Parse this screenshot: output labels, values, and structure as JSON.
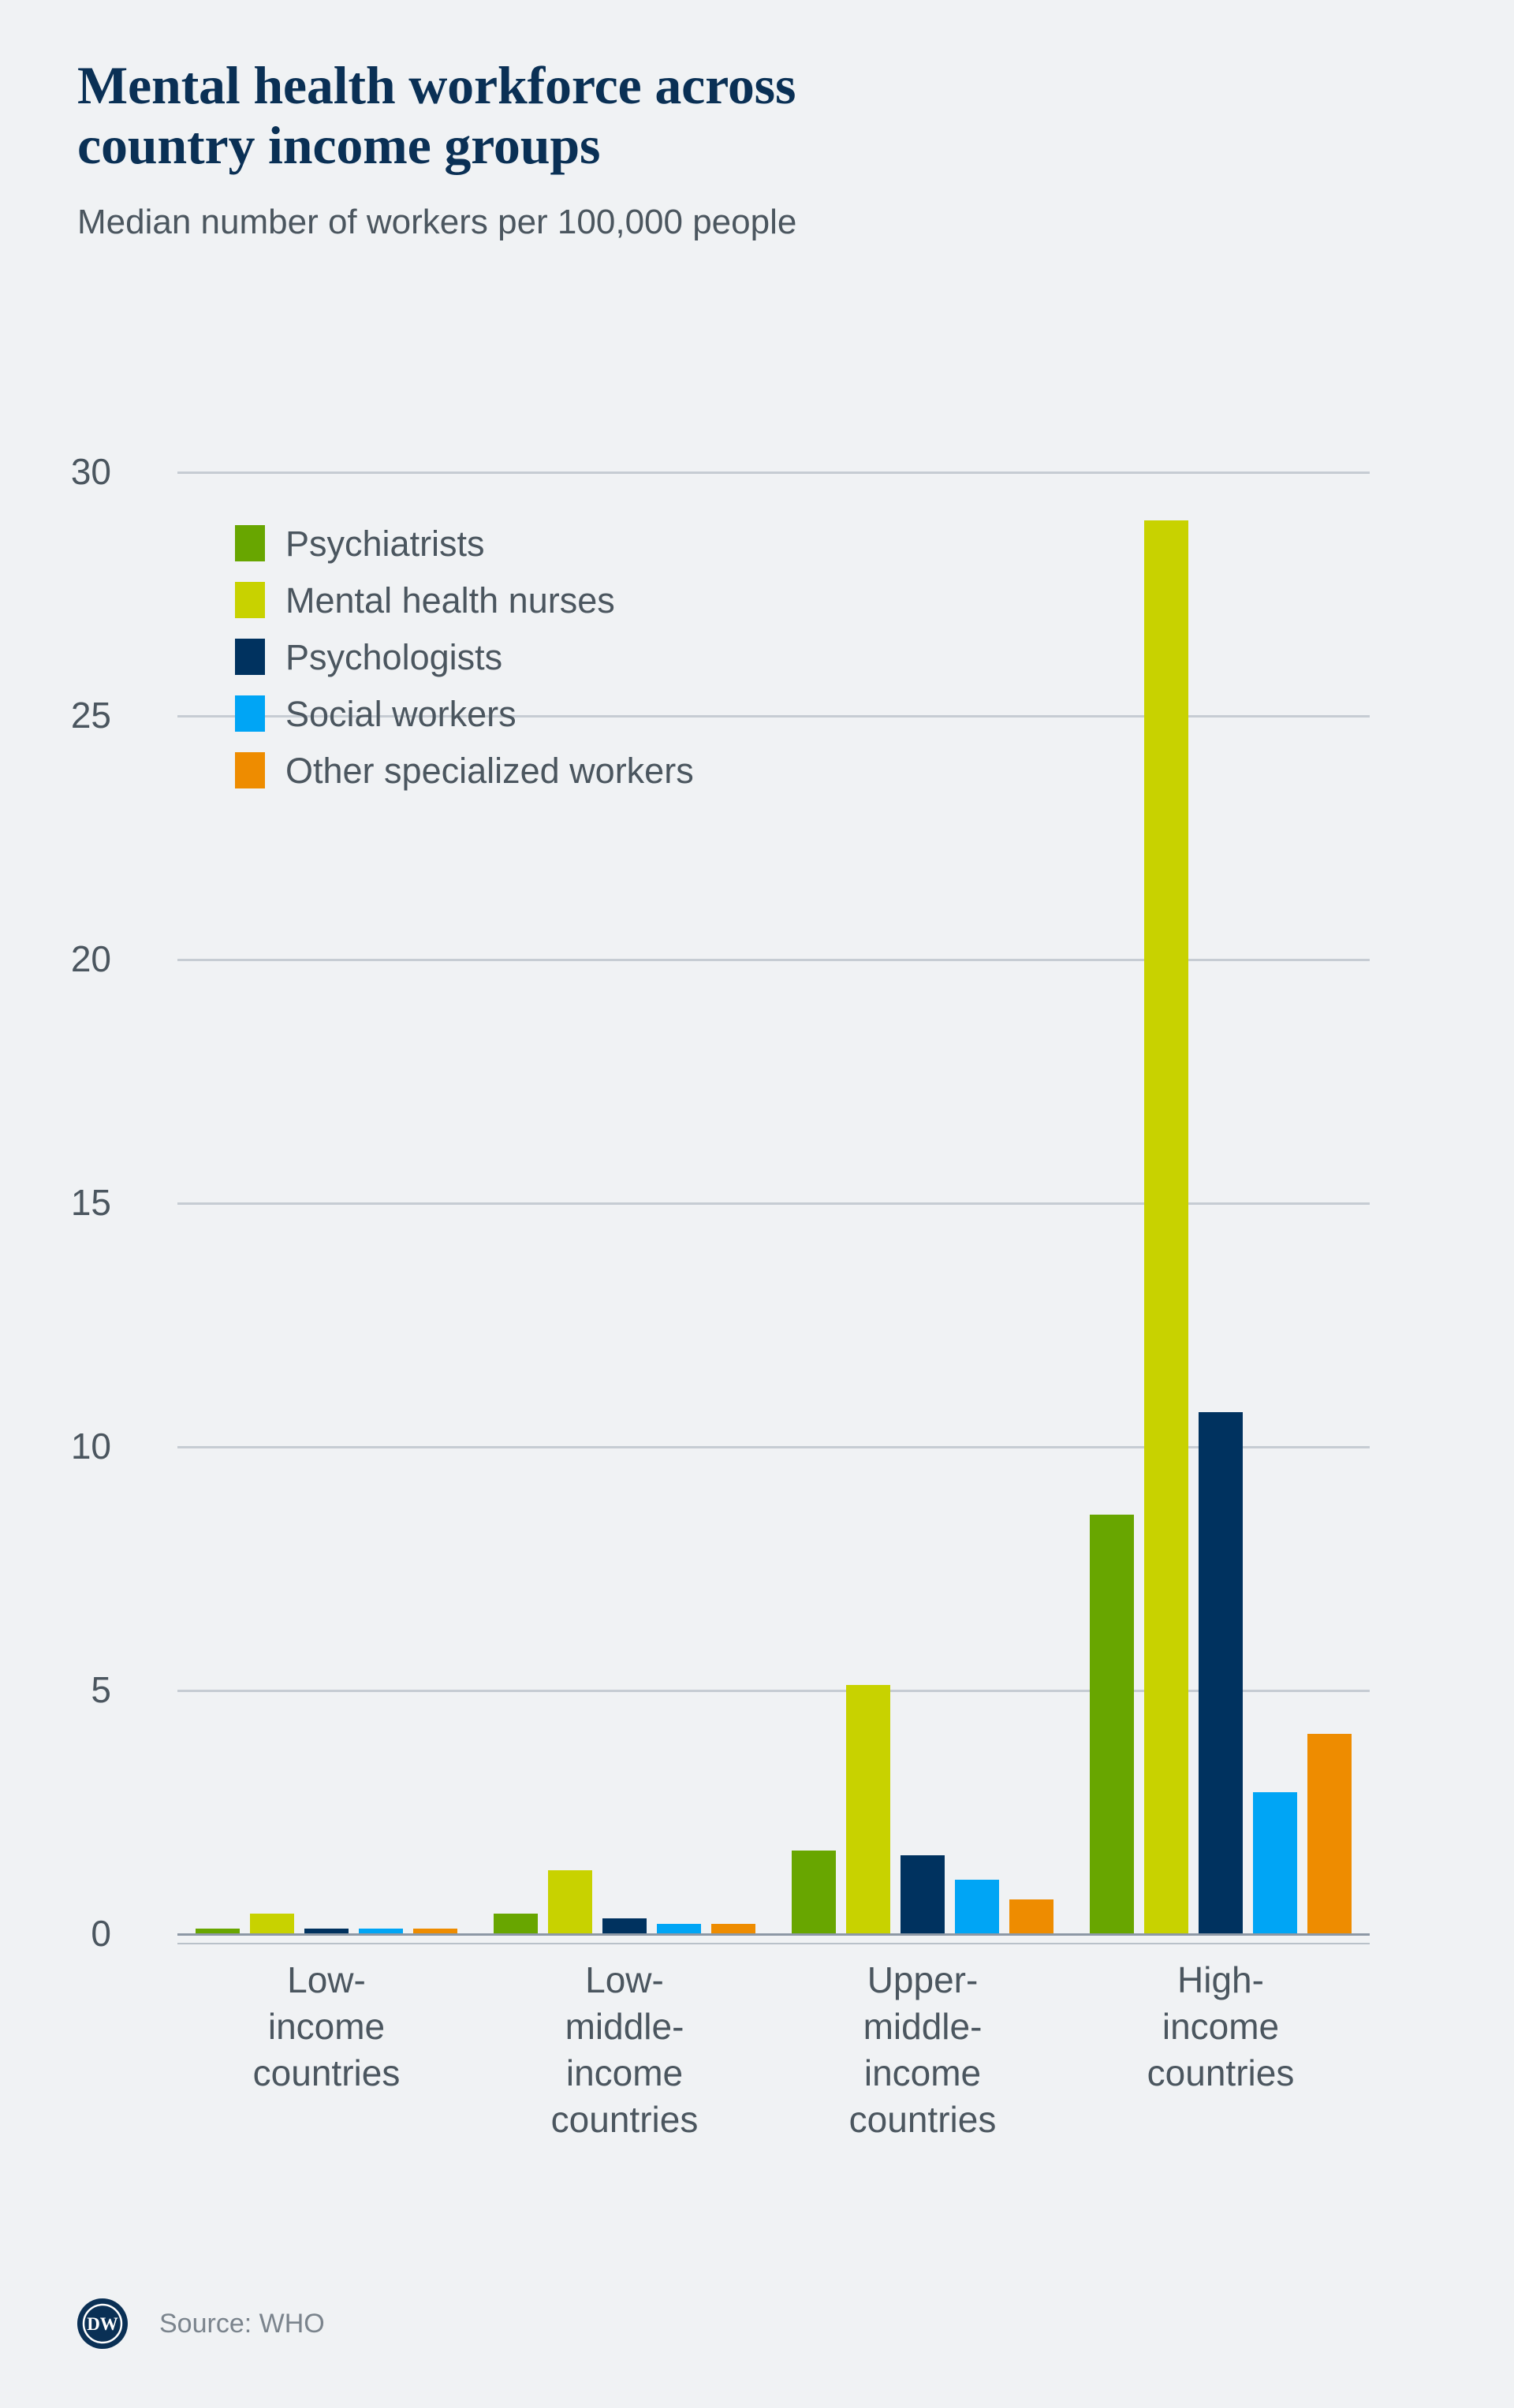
{
  "header": {
    "title": "Mental health workforce across\ncountry income groups",
    "subtitle": "Median number of workers per 100,000 people"
  },
  "footer": {
    "source": "Source: WHO",
    "logo_alt": "dw-logo"
  },
  "colors": {
    "background": "#f0f2f4",
    "title": "#0a3055",
    "text": "#4b565f",
    "gridline": "#c6ccd3",
    "axis": "#8d98a5",
    "psychiatrists": "#68a600",
    "mental_health_nurses": "#c8d200",
    "psychologists": "#00325f",
    "social_workers": "#00a5f5",
    "other_specialized_workers": "#ee8c00"
  },
  "axis": {
    "y_ticks": [
      "0",
      "5",
      "10",
      "15",
      "20",
      "25",
      "30"
    ]
  },
  "chart_data": {
    "type": "bar",
    "title": "Mental health workforce across country income groups",
    "subtitle": "Median number of workers per 100,000 people",
    "xlabel": "",
    "ylabel": "Median number of workers per 100,000 people",
    "ylim": [
      0,
      30
    ],
    "yticks": [
      0,
      5,
      10,
      15,
      20,
      25,
      30
    ],
    "grid": true,
    "legend_position": "top-left inside plot",
    "categories": [
      "Low-\nincome\ncountries",
      "Low-\nmiddle-\nincome\ncountries",
      "Upper-\nmiddle-\nincome\ncountries",
      "High-\nincome\ncountries"
    ],
    "series": [
      {
        "name": "Psychiatrists",
        "color": "#68a600",
        "values": [
          0.1,
          0.4,
          1.7,
          8.6
        ]
      },
      {
        "name": "Mental health nurses",
        "color": "#c8d200",
        "values": [
          0.4,
          1.3,
          5.1,
          29.0
        ]
      },
      {
        "name": "Psychologists",
        "color": "#00325f",
        "values": [
          0.1,
          0.3,
          1.6,
          10.7
        ]
      },
      {
        "name": "Social workers",
        "color": "#00a5f5",
        "values": [
          0.1,
          0.2,
          1.1,
          2.9
        ]
      },
      {
        "name": "Other specialized workers",
        "color": "#ee8c00",
        "values": [
          0.1,
          0.2,
          0.7,
          4.1
        ]
      }
    ],
    "source": "Source: WHO"
  }
}
